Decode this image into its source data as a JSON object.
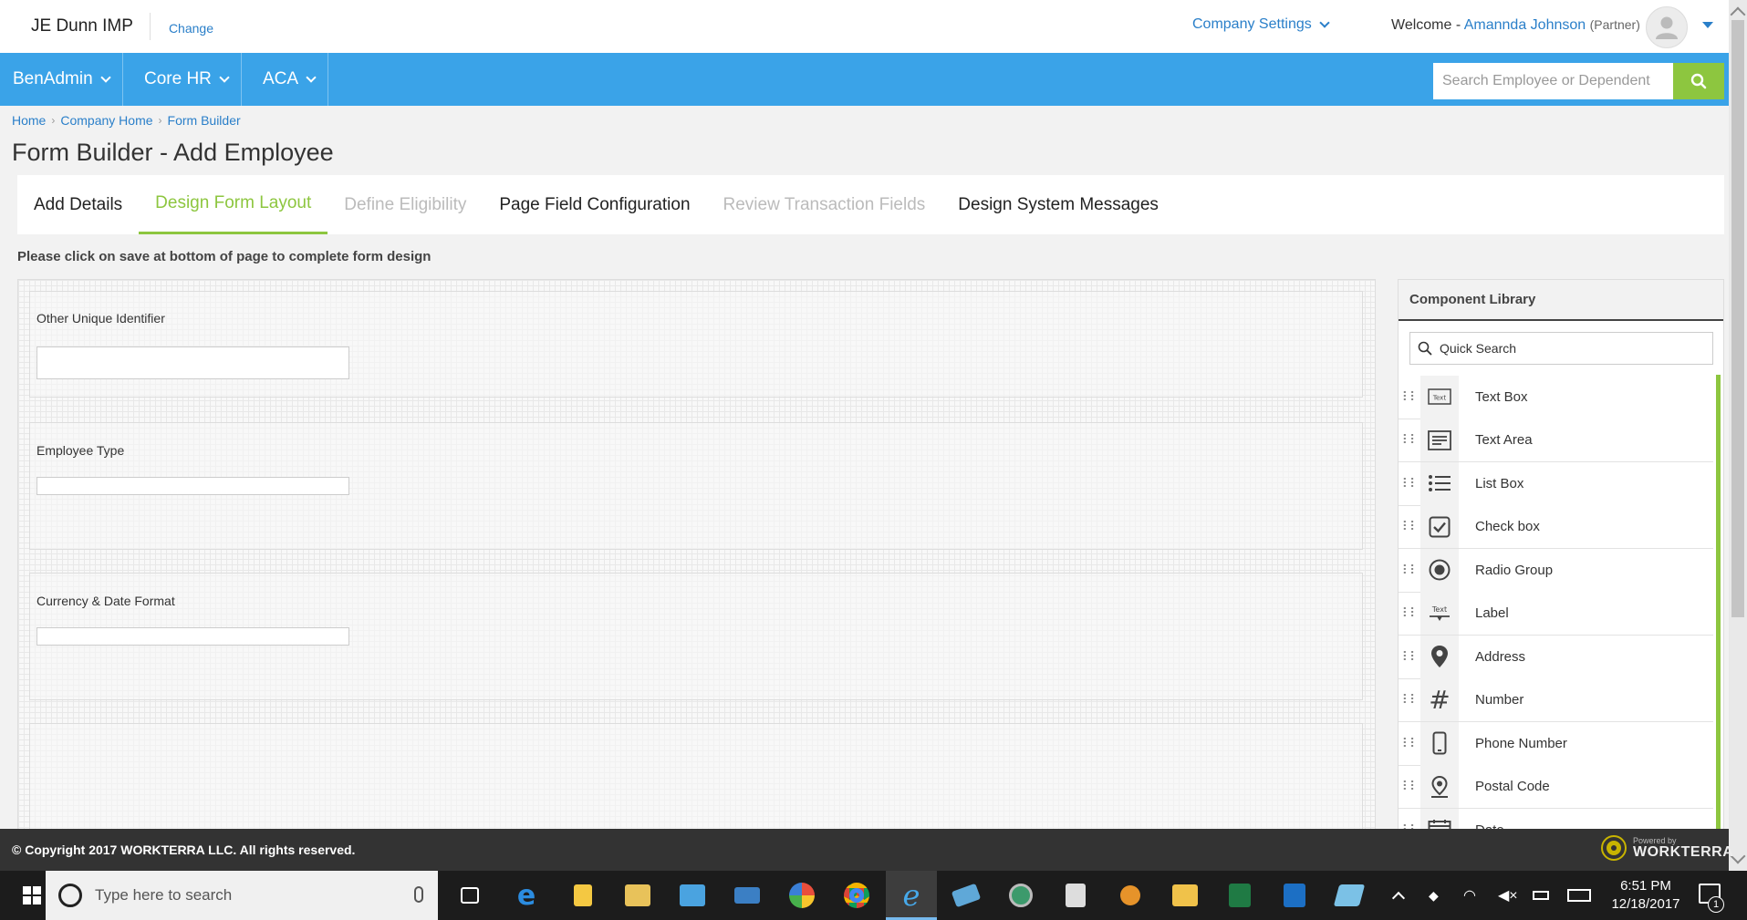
{
  "header": {
    "company": "JE Dunn IMP",
    "change_link": "Change",
    "company_settings": "Company Settings",
    "welcome_prefix": "Welcome -",
    "user_name": "Amannda Johnson",
    "user_role": "(Partner)"
  },
  "nav": {
    "items": [
      {
        "label": "BenAdmin"
      },
      {
        "label": "Core HR"
      },
      {
        "label": "ACA"
      }
    ],
    "search_placeholder": "Search Employee or Dependent"
  },
  "breadcrumb": {
    "items": [
      {
        "label": "Home"
      },
      {
        "label": "Company Home"
      },
      {
        "label": "Form Builder"
      }
    ]
  },
  "page": {
    "title": "Form Builder - Add Employee",
    "instruction": "Please click on save at bottom of page to complete form design"
  },
  "tabs": [
    {
      "label": "Add Details",
      "state": "normal"
    },
    {
      "label": "Design Form Layout",
      "state": "active"
    },
    {
      "label": "Define Eligibility",
      "state": "disabled"
    },
    {
      "label": "Page Field Configuration",
      "state": "normal"
    },
    {
      "label": "Review Transaction Fields",
      "state": "disabled"
    },
    {
      "label": "Design System Messages",
      "state": "normal"
    }
  ],
  "form_fields": [
    {
      "label": "Other Unique Identifier",
      "value": ""
    },
    {
      "label": "Employee Type",
      "value": ""
    },
    {
      "label": "Currency & Date Format",
      "value": ""
    }
  ],
  "library": {
    "title": "Component Library",
    "search_placeholder": "Quick Search",
    "items": [
      {
        "label": "Text Box",
        "icon": "text-box-icon"
      },
      {
        "label": "Text Area",
        "icon": "text-area-icon"
      },
      {
        "label": "List Box",
        "icon": "list-box-icon"
      },
      {
        "label": "Check box",
        "icon": "checkbox-icon"
      },
      {
        "label": "Radio Group",
        "icon": "radio-icon"
      },
      {
        "label": "Label",
        "icon": "label-icon"
      },
      {
        "label": "Address",
        "icon": "map-pin-icon"
      },
      {
        "label": "Number",
        "icon": "hash-icon"
      },
      {
        "label": "Phone Number",
        "icon": "phone-icon"
      },
      {
        "label": "Postal Code",
        "icon": "postal-pin-icon"
      },
      {
        "label": "Date",
        "icon": "calendar-icon"
      }
    ]
  },
  "footer": {
    "copyright": "© Copyright 2017 WORKTERRA LLC. All rights reserved.",
    "powered_by": "Powered by",
    "brand": "WORKTERRA"
  },
  "taskbar": {
    "search_placeholder": "Type here to search",
    "time": "6:51 PM",
    "date": "12/18/2017",
    "notification_count": "1"
  },
  "colors": {
    "nav_blue": "#3aa3e8",
    "accent_green": "#8dc63f",
    "link_blue": "#2a7fc9"
  }
}
